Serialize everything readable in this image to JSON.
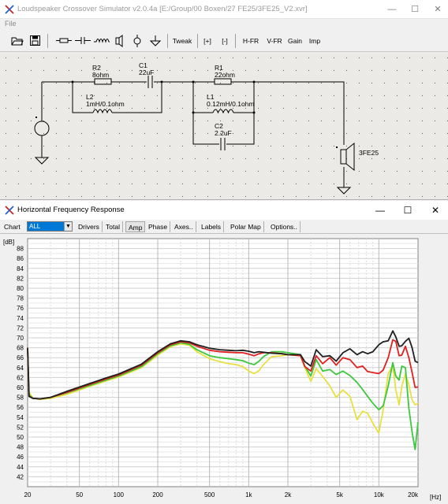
{
  "main_window": {
    "title": "Loudspeaker Crossover Simulator v2.0.4a [E:/Group/00 Boxen/27 FE25/3FE25_V2.xvr]",
    "controls": {
      "minimize": "—",
      "maximize": "☐",
      "close": "✕"
    }
  },
  "menu": {
    "file": "File"
  },
  "toolbar": {
    "tweak": "Tweak",
    "zoom_in": "[+]",
    "zoom_out": "[-]",
    "hfr": "H-FR",
    "vfr": "V-FR",
    "gain": "Gain",
    "imp": "Imp"
  },
  "schematic": {
    "r2_name": "R2",
    "r2_value": "8ohm",
    "c1_name": "C1",
    "c1_value": "22uF",
    "l2_name": "L2",
    "l2_value": "1mH/0.1ohm",
    "r1_name": "R1",
    "r1_value": "22ohm",
    "l1_name": "L1",
    "l1_value": "0.12mH/0.1ohm",
    "c2_name": "C2",
    "c2_value": "2.2uF",
    "driver_name": "3FE25"
  },
  "fr_window": {
    "title": "Horizontal Frequency Response",
    "controls": {
      "minimize": "—",
      "maximize": "☐",
      "close": "✕"
    }
  },
  "fr_toolbar": {
    "chart_label": "Chart",
    "chart_value": "ALL",
    "drivers": "Drivers",
    "total": "Total",
    "amp": "Amp",
    "phase": "Phase",
    "axes": "Axes..",
    "labels": "Labels",
    "polar_map": "Polar Map",
    "options": "Options.."
  },
  "chart_data": {
    "type": "line",
    "xscale": "log",
    "xlim": [
      20,
      20000
    ],
    "ylim": [
      40,
      90
    ],
    "ylabel": "[dB]",
    "xlabel": "[Hz]",
    "grid": true,
    "x_ticks": [
      {
        "v": 20,
        "l": "20"
      },
      {
        "v": 50,
        "l": "50"
      },
      {
        "v": 100,
        "l": "100"
      },
      {
        "v": 200,
        "l": "200"
      },
      {
        "v": 500,
        "l": "500"
      },
      {
        "v": 1000,
        "l": "1k"
      },
      {
        "v": 2000,
        "l": "2k"
      },
      {
        "v": 5000,
        "l": "5k"
      },
      {
        "v": 10000,
        "l": "10k"
      },
      {
        "v": 20000,
        "l": "20k"
      }
    ],
    "y_ticks": [
      42,
      44,
      46,
      48,
      50,
      52,
      54,
      56,
      58,
      60,
      62,
      64,
      66,
      68,
      70,
      72,
      74,
      76,
      78,
      80,
      82,
      84,
      86,
      88
    ],
    "series": [
      {
        "color": "#e8e040",
        "points": [
          [
            20,
            68
          ],
          [
            20.5,
            59
          ],
          [
            22,
            57.8
          ],
          [
            25,
            57.6
          ],
          [
            30,
            57.8
          ],
          [
            40,
            58.6
          ],
          [
            60,
            60.2
          ],
          [
            80,
            61.3
          ],
          [
            100,
            62.1
          ],
          [
            150,
            64
          ],
          [
            200,
            66.5
          ],
          [
            250,
            68.2
          ],
          [
            300,
            68.8
          ],
          [
            350,
            68.5
          ],
          [
            400,
            67.2
          ],
          [
            500,
            65.8
          ],
          [
            600,
            65.2
          ],
          [
            700,
            64.8
          ],
          [
            800,
            64.6
          ],
          [
            900,
            64.2
          ],
          [
            1000,
            63.3
          ],
          [
            1100,
            62.8
          ],
          [
            1200,
            63.4
          ],
          [
            1300,
            64.6
          ],
          [
            1500,
            66.2
          ],
          [
            1800,
            66.4
          ],
          [
            2000,
            66.6
          ],
          [
            2500,
            66.4
          ],
          [
            2700,
            64
          ],
          [
            3000,
            61.2
          ],
          [
            3300,
            63.8
          ],
          [
            3700,
            62.2
          ],
          [
            4200,
            60.3
          ],
          [
            4700,
            58
          ],
          [
            5300,
            59.5
          ],
          [
            6000,
            58.2
          ],
          [
            6800,
            53.5
          ],
          [
            7500,
            55.2
          ],
          [
            8200,
            54.8
          ],
          [
            9000,
            52.8
          ],
          [
            10000,
            50.8
          ],
          [
            10800,
            55.5
          ],
          [
            11800,
            62.8
          ],
          [
            12800,
            64.5
          ],
          [
            13500,
            59.5
          ],
          [
            14300,
            56.5
          ],
          [
            15000,
            60.2
          ],
          [
            16000,
            62.8
          ],
          [
            17000,
            60.5
          ],
          [
            18000,
            57.5
          ],
          [
            19000,
            56.5
          ],
          [
            20000,
            56.8
          ]
        ]
      },
      {
        "color": "#3cc83c",
        "points": [
          [
            20,
            68
          ],
          [
            20.5,
            58.5
          ],
          [
            22,
            57.8
          ],
          [
            25,
            57.7
          ],
          [
            30,
            58
          ],
          [
            40,
            58.9
          ],
          [
            60,
            60.4
          ],
          [
            80,
            61.5
          ],
          [
            100,
            62.3
          ],
          [
            150,
            64.2
          ],
          [
            200,
            66.8
          ],
          [
            250,
            68.4
          ],
          [
            300,
            69
          ],
          [
            350,
            68.7
          ],
          [
            400,
            67.6
          ],
          [
            500,
            66.4
          ],
          [
            600,
            66
          ],
          [
            700,
            65.8
          ],
          [
            800,
            65.6
          ],
          [
            900,
            65.4
          ],
          [
            1000,
            64.9
          ],
          [
            1100,
            64.6
          ],
          [
            1200,
            65.3
          ],
          [
            1300,
            66.2
          ],
          [
            1500,
            67.2
          ],
          [
            1800,
            67.2
          ],
          [
            2000,
            67
          ],
          [
            2500,
            66.6
          ],
          [
            2700,
            64.3
          ],
          [
            3000,
            62.3
          ],
          [
            3300,
            65.6
          ],
          [
            3700,
            63.3
          ],
          [
            4200,
            63.6
          ],
          [
            4700,
            62.6
          ],
          [
            5300,
            63.3
          ],
          [
            6000,
            62.4
          ],
          [
            6800,
            61
          ],
          [
            7500,
            59.6
          ],
          [
            8200,
            58.2
          ],
          [
            9000,
            56.8
          ],
          [
            10000,
            55.5
          ],
          [
            10800,
            56.3
          ],
          [
            11800,
            60.3
          ],
          [
            12800,
            65
          ],
          [
            13500,
            62.3
          ],
          [
            14300,
            61.5
          ],
          [
            15000,
            64.3
          ],
          [
            16000,
            64
          ],
          [
            17000,
            55.8
          ],
          [
            18000,
            51
          ],
          [
            19000,
            47.5
          ],
          [
            20000,
            53
          ]
        ]
      },
      {
        "color": "#e02020",
        "points": [
          [
            20,
            68
          ],
          [
            20.5,
            58.3
          ],
          [
            22,
            57.8
          ],
          [
            25,
            57.7
          ],
          [
            30,
            58
          ],
          [
            40,
            59
          ],
          [
            60,
            60.6
          ],
          [
            80,
            61.7
          ],
          [
            100,
            62.5
          ],
          [
            150,
            64.5
          ],
          [
            200,
            67
          ],
          [
            250,
            68.6
          ],
          [
            300,
            69.2
          ],
          [
            350,
            69
          ],
          [
            400,
            68.3
          ],
          [
            500,
            67.5
          ],
          [
            600,
            67.2
          ],
          [
            700,
            67.1
          ],
          [
            800,
            67
          ],
          [
            900,
            67
          ],
          [
            1000,
            66.7
          ],
          [
            1100,
            66.4
          ],
          [
            1200,
            66.8
          ],
          [
            1300,
            67
          ],
          [
            1500,
            67
          ],
          [
            1800,
            66.8
          ],
          [
            2000,
            66.6
          ],
          [
            2500,
            66.4
          ],
          [
            2700,
            64.2
          ],
          [
            3000,
            63.3
          ],
          [
            3300,
            66.4
          ],
          [
            3700,
            64.8
          ],
          [
            4200,
            66
          ],
          [
            4700,
            64.5
          ],
          [
            5300,
            66
          ],
          [
            6000,
            65.6
          ],
          [
            6800,
            64
          ],
          [
            7500,
            64.3
          ],
          [
            8200,
            63.2
          ],
          [
            9000,
            63
          ],
          [
            10000,
            62.8
          ],
          [
            10800,
            63.5
          ],
          [
            11800,
            66
          ],
          [
            12800,
            69.6
          ],
          [
            13500,
            69.3
          ],
          [
            14300,
            66.4
          ],
          [
            15000,
            66.5
          ],
          [
            16000,
            68.3
          ],
          [
            17000,
            66
          ],
          [
            18000,
            63
          ],
          [
            19000,
            60
          ],
          [
            20000,
            60.1
          ]
        ]
      },
      {
        "color": "#202020",
        "points": [
          [
            20,
            68
          ],
          [
            20.5,
            58.2
          ],
          [
            22,
            57.8
          ],
          [
            25,
            57.7
          ],
          [
            30,
            58
          ],
          [
            40,
            59.2
          ],
          [
            60,
            60.8
          ],
          [
            80,
            61.9
          ],
          [
            100,
            62.7
          ],
          [
            150,
            64.7
          ],
          [
            200,
            67.2
          ],
          [
            250,
            68.8
          ],
          [
            300,
            69.4
          ],
          [
            350,
            69.2
          ],
          [
            400,
            68.6
          ],
          [
            500,
            67.9
          ],
          [
            600,
            67.6
          ],
          [
            700,
            67.5
          ],
          [
            800,
            67.4
          ],
          [
            900,
            67.5
          ],
          [
            1000,
            67.3
          ],
          [
            1100,
            67
          ],
          [
            1200,
            67.2
          ],
          [
            1300,
            67.1
          ],
          [
            1500,
            66.9
          ],
          [
            1800,
            66.8
          ],
          [
            2000,
            66.6
          ],
          [
            2500,
            66.6
          ],
          [
            2700,
            65.2
          ],
          [
            3000,
            64.3
          ],
          [
            3300,
            67.6
          ],
          [
            3700,
            66.2
          ],
          [
            4200,
            66.4
          ],
          [
            4700,
            65.3
          ],
          [
            5300,
            67
          ],
          [
            6000,
            67.8
          ],
          [
            6800,
            66.6
          ],
          [
            7500,
            67.2
          ],
          [
            8200,
            66.8
          ],
          [
            9000,
            67.2
          ],
          [
            10000,
            68.6
          ],
          [
            10800,
            69.2
          ],
          [
            11800,
            69.4
          ],
          [
            12800,
            71.4
          ],
          [
            13500,
            70.2
          ],
          [
            14300,
            68.3
          ],
          [
            15000,
            68.4
          ],
          [
            16000,
            69.3
          ],
          [
            17000,
            69.9
          ],
          [
            18000,
            68
          ],
          [
            19000,
            65.3
          ],
          [
            20000,
            65
          ]
        ]
      }
    ]
  }
}
